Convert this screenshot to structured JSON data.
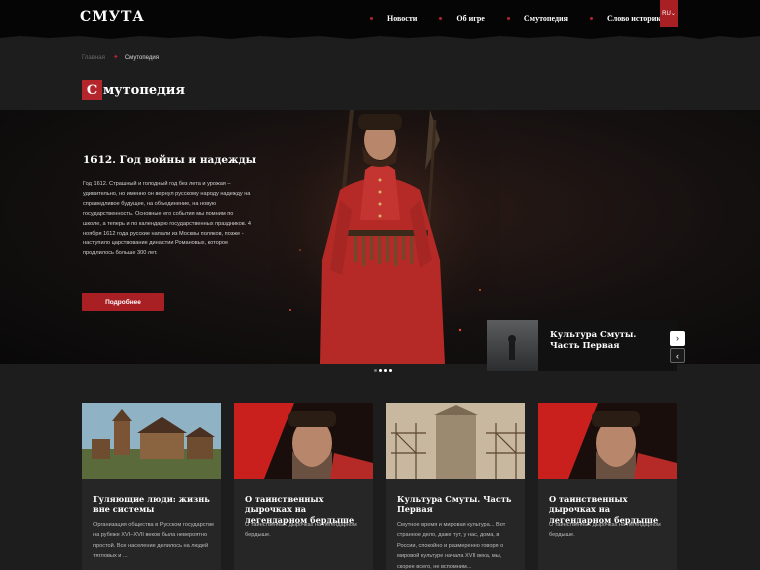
{
  "header": {
    "logo": "СМУТА",
    "nav": [
      "Новости",
      "Об игре",
      "Смутопедия",
      "Слово историкам"
    ],
    "lang": "RU"
  },
  "breadcrumb": {
    "home": "Главная",
    "current": "Смутопедия"
  },
  "page_title": {
    "cap": "С",
    "rest": "мутопедия"
  },
  "hero": {
    "title": "1612. Год войны и надежды",
    "text": "Год 1612. Страшный и голодный год без лета и урожая – удивительно, но именно он вернул русскому народу надежду на справедливое будущее, на объединение, на новую государственность. Основные его события мы помним по школе, а теперь и по календарю государственных праздников. 4 ноября 1612 года русские напали из Москвы поляков, позже - наступило царствование династии Романовых, которое продлилось больше 300 лет.",
    "button": "Подробнее"
  },
  "side_card": {
    "title": "Культура Смуты. Часть Первая"
  },
  "arrows": {
    "next": "›",
    "prev": "‹"
  },
  "cards": [
    {
      "title": "Гуляющие люди: жизнь вне системы",
      "text": "Организация общества в Русском государстве на рубеже XVI–XVII веков была невероятно простой. Все население делилось на людей тягловых и ..."
    },
    {
      "title": "О таинственных дырочках на легендарном бердыше",
      "text": "О таинственных дырочках на легендарном бердыше."
    },
    {
      "title": "Культура Смуты. Часть Первая",
      "text": "Смутное время и мировая культура... Вот странное дело, даже тут, у нас, дома, в России, спокойно и размеренно говоря о мировой культуре начала XVII века, мы, скорее всего, не вспомним..."
    },
    {
      "title": "О таинственных дырочках на легендарном бердыше",
      "text": "О таинственных дырочках на легендарном бердыше."
    }
  ],
  "colors": {
    "accent": "#a81f24",
    "bg": "#1d1d1d",
    "header": "#050505",
    "card": "#262626"
  }
}
